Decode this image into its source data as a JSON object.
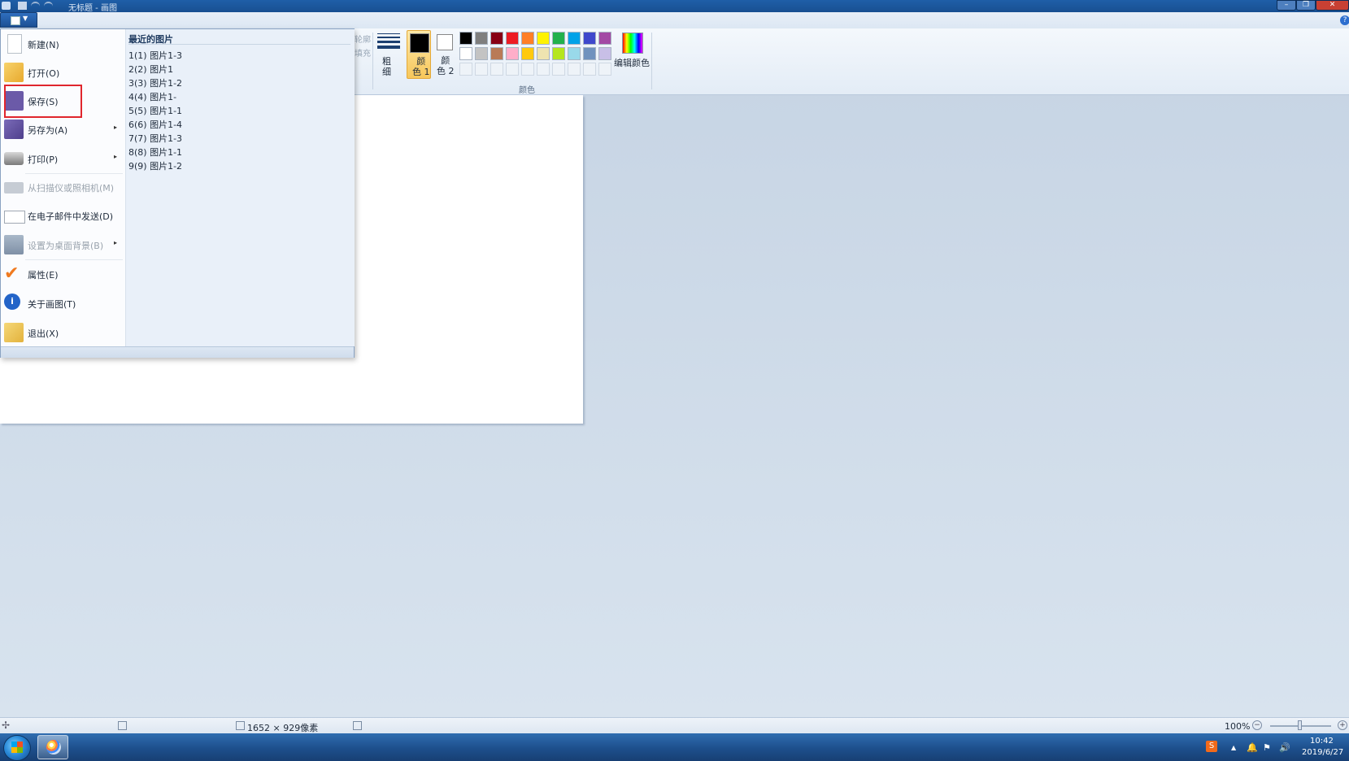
{
  "window": {
    "title": "无标题 - 画图",
    "minimize_glyph": "–",
    "maximize_glyph": "❐",
    "close_glyph": "✕"
  },
  "ribbon": {
    "help_glyph": "?",
    "ghost_labels": [
      "轮廓",
      "填充"
    ],
    "outline_label_line1": "粗",
    "outline_label_line2": "细",
    "color1_label_line1": "颜",
    "color1_label_line2": "色 1",
    "color2_label_line1": "颜",
    "color2_label_line2": "色 2",
    "edit_colors_label": "编辑颜色",
    "colors_group_label": "颜色",
    "color1_value": "#000000",
    "color2_value": "#ffffff",
    "palette_row1": [
      "#000000",
      "#7f7f7f",
      "#880015",
      "#ed1c24",
      "#ff7f27",
      "#fff200",
      "#22b14c",
      "#00a2e8",
      "#3f48cc",
      "#a349a4"
    ],
    "palette_row2": [
      "#ffffff",
      "#c3c3c3",
      "#b97a57",
      "#ffaec9",
      "#ffc90e",
      "#efe4b0",
      "#b5e61d",
      "#99d9ea",
      "#7092be",
      "#c8bfe7"
    ]
  },
  "app_menu": {
    "items": [
      {
        "label": "新建(N)",
        "icon": "new-document-icon",
        "enabled": true,
        "submenu": false
      },
      {
        "label": "打开(O)",
        "icon": "open-folder-icon",
        "enabled": true,
        "submenu": false
      },
      {
        "label": "保存(S)",
        "icon": "save-disk-icon",
        "enabled": true,
        "submenu": false
      },
      {
        "label": "另存为(A)",
        "icon": "save-as-icon",
        "enabled": true,
        "submenu": true
      },
      {
        "label": "打印(P)",
        "icon": "printer-icon",
        "enabled": true,
        "submenu": true
      },
      {
        "label": "从扫描仪或照相机(M)",
        "icon": "scanner-icon",
        "enabled": false,
        "submenu": false
      },
      {
        "label": "在电子邮件中发送(D)",
        "icon": "email-icon",
        "enabled": true,
        "submenu": false
      },
      {
        "label": "设置为桌面背景(B)",
        "icon": "desktop-background-icon",
        "enabled": false,
        "submenu": true
      },
      {
        "label": "属性(E)",
        "icon": "checkmark-icon",
        "enabled": true,
        "submenu": false
      },
      {
        "label": "关于画图(T)",
        "icon": "info-icon",
        "enabled": true,
        "submenu": false
      },
      {
        "label": "退出(X)",
        "icon": "exit-icon",
        "enabled": true,
        "submenu": false
      }
    ],
    "recent_title": "最近的图片",
    "recent_items": [
      "1(1) 图片1-3",
      "2(2) 图片1",
      "3(3) 图片1-2",
      "4(4) 图片1-",
      "5(5) 图片1-1",
      "6(6) 图片1-4",
      "7(7) 图片1-3",
      "8(8) 图片1-1",
      "9(9) 图片1-2"
    ]
  },
  "statusbar": {
    "image_size": "1652 × 929像素",
    "zoom": "100%",
    "zoom_out_glyph": "−",
    "zoom_in_glyph": "+"
  },
  "taskbar": {
    "time": "10:42",
    "date": "2019/6/27",
    "ime_label": "S",
    "tray_icons": [
      "▲",
      "🔔",
      "⚑",
      "🔊"
    ]
  }
}
